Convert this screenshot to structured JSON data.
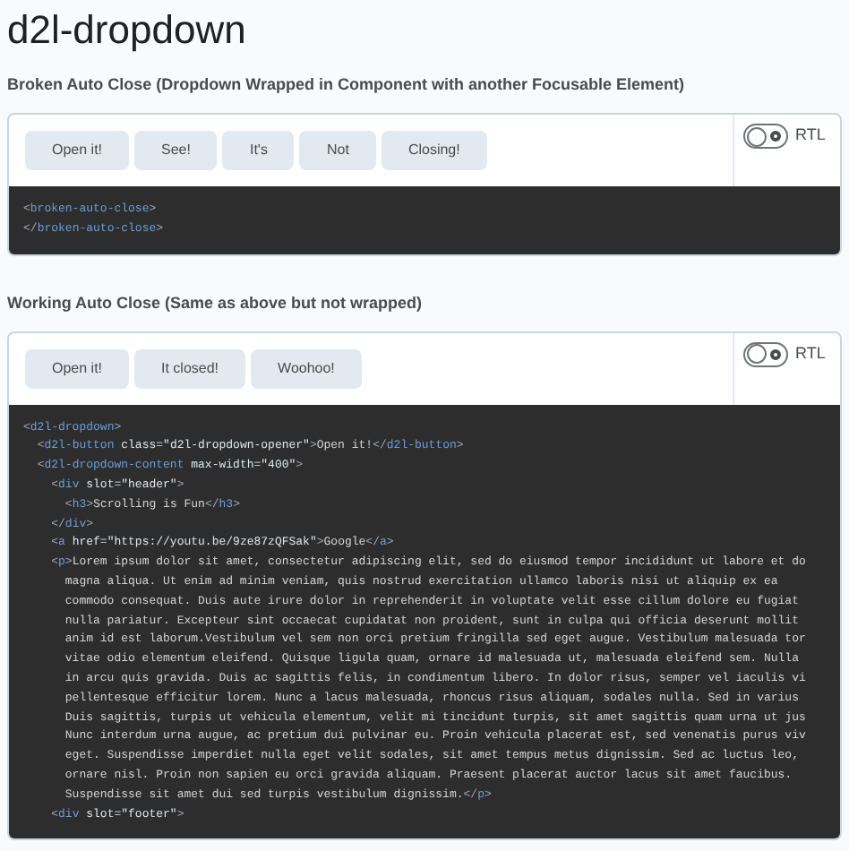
{
  "title": "d2l-dropdown",
  "demos": [
    {
      "heading": "Broken Auto Close (Dropdown Wrapped in Component with another Focusable Element)",
      "buttons": [
        "Open it!",
        "See!",
        "It's",
        "Not",
        "Closing!"
      ],
      "rtl": {
        "label": "RTL",
        "on": false
      },
      "code": [
        "<broken-auto-close>",
        "</broken-auto-close>"
      ]
    },
    {
      "heading": "Working Auto Close (Same as above but not wrapped)",
      "buttons": [
        "Open it!",
        "It closed!",
        "Woohoo!"
      ],
      "rtl": {
        "label": "RTL",
        "on": false
      },
      "code": [
        "<d2l-dropdown>",
        "  <d2l-button class=\"d2l-dropdown-opener\">Open it!</d2l-button>",
        "  <d2l-dropdown-content max-width=\"400\">",
        "    <div slot=\"header\">",
        "      <h3>Scrolling is Fun</h3>",
        "    </div>",
        "    <a href=\"https://youtu.be/9ze87zQFSak\">Google</a>",
        "    <p>Lorem ipsum dolor sit amet, consectetur adipiscing elit, sed do eiusmod tempor incididunt ut labore et do",
        "      magna aliqua. Ut enim ad minim veniam, quis nostrud exercitation ullamco laboris nisi ut aliquip ex ea",
        "      commodo consequat. Duis aute irure dolor in reprehenderit in voluptate velit esse cillum dolore eu fugiat",
        "      nulla pariatur. Excepteur sint occaecat cupidatat non proident, sunt in culpa qui officia deserunt mollit",
        "      anim id est laborum.Vestibulum vel sem non orci pretium fringilla sed eget augue. Vestibulum malesuada tor",
        "      vitae odio elementum eleifend. Quisque ligula quam, ornare id malesuada ut, malesuada eleifend sem. Nulla",
        "      in arcu quis gravida. Duis ac sagittis felis, in condimentum libero. In dolor risus, semper vel iaculis vi",
        "      pellentesque efficitur lorem. Nunc a lacus malesuada, rhoncus risus aliquam, sodales nulla. Sed in varius",
        "      Duis sagittis, turpis ut vehicula elementum, velit mi tincidunt turpis, sit amet sagittis quam urna ut jus",
        "      Nunc interdum urna augue, ac pretium dui pulvinar eu. Proin vehicula placerat est, sed venenatis purus viv",
        "      eget. Suspendisse imperdiet nulla eget velit sodales, sit amet tempus metus dignissim. Sed ac luctus leo,",
        "      ornare nisl. Proin non sapien eu orci gravida aliquam. Praesent placerat auctor lacus sit amet faucibus.",
        "      Suspendisse sit amet dui sed turpis vestibulum dignissim.</p>",
        "    <div slot=\"footer\">"
      ]
    }
  ]
}
